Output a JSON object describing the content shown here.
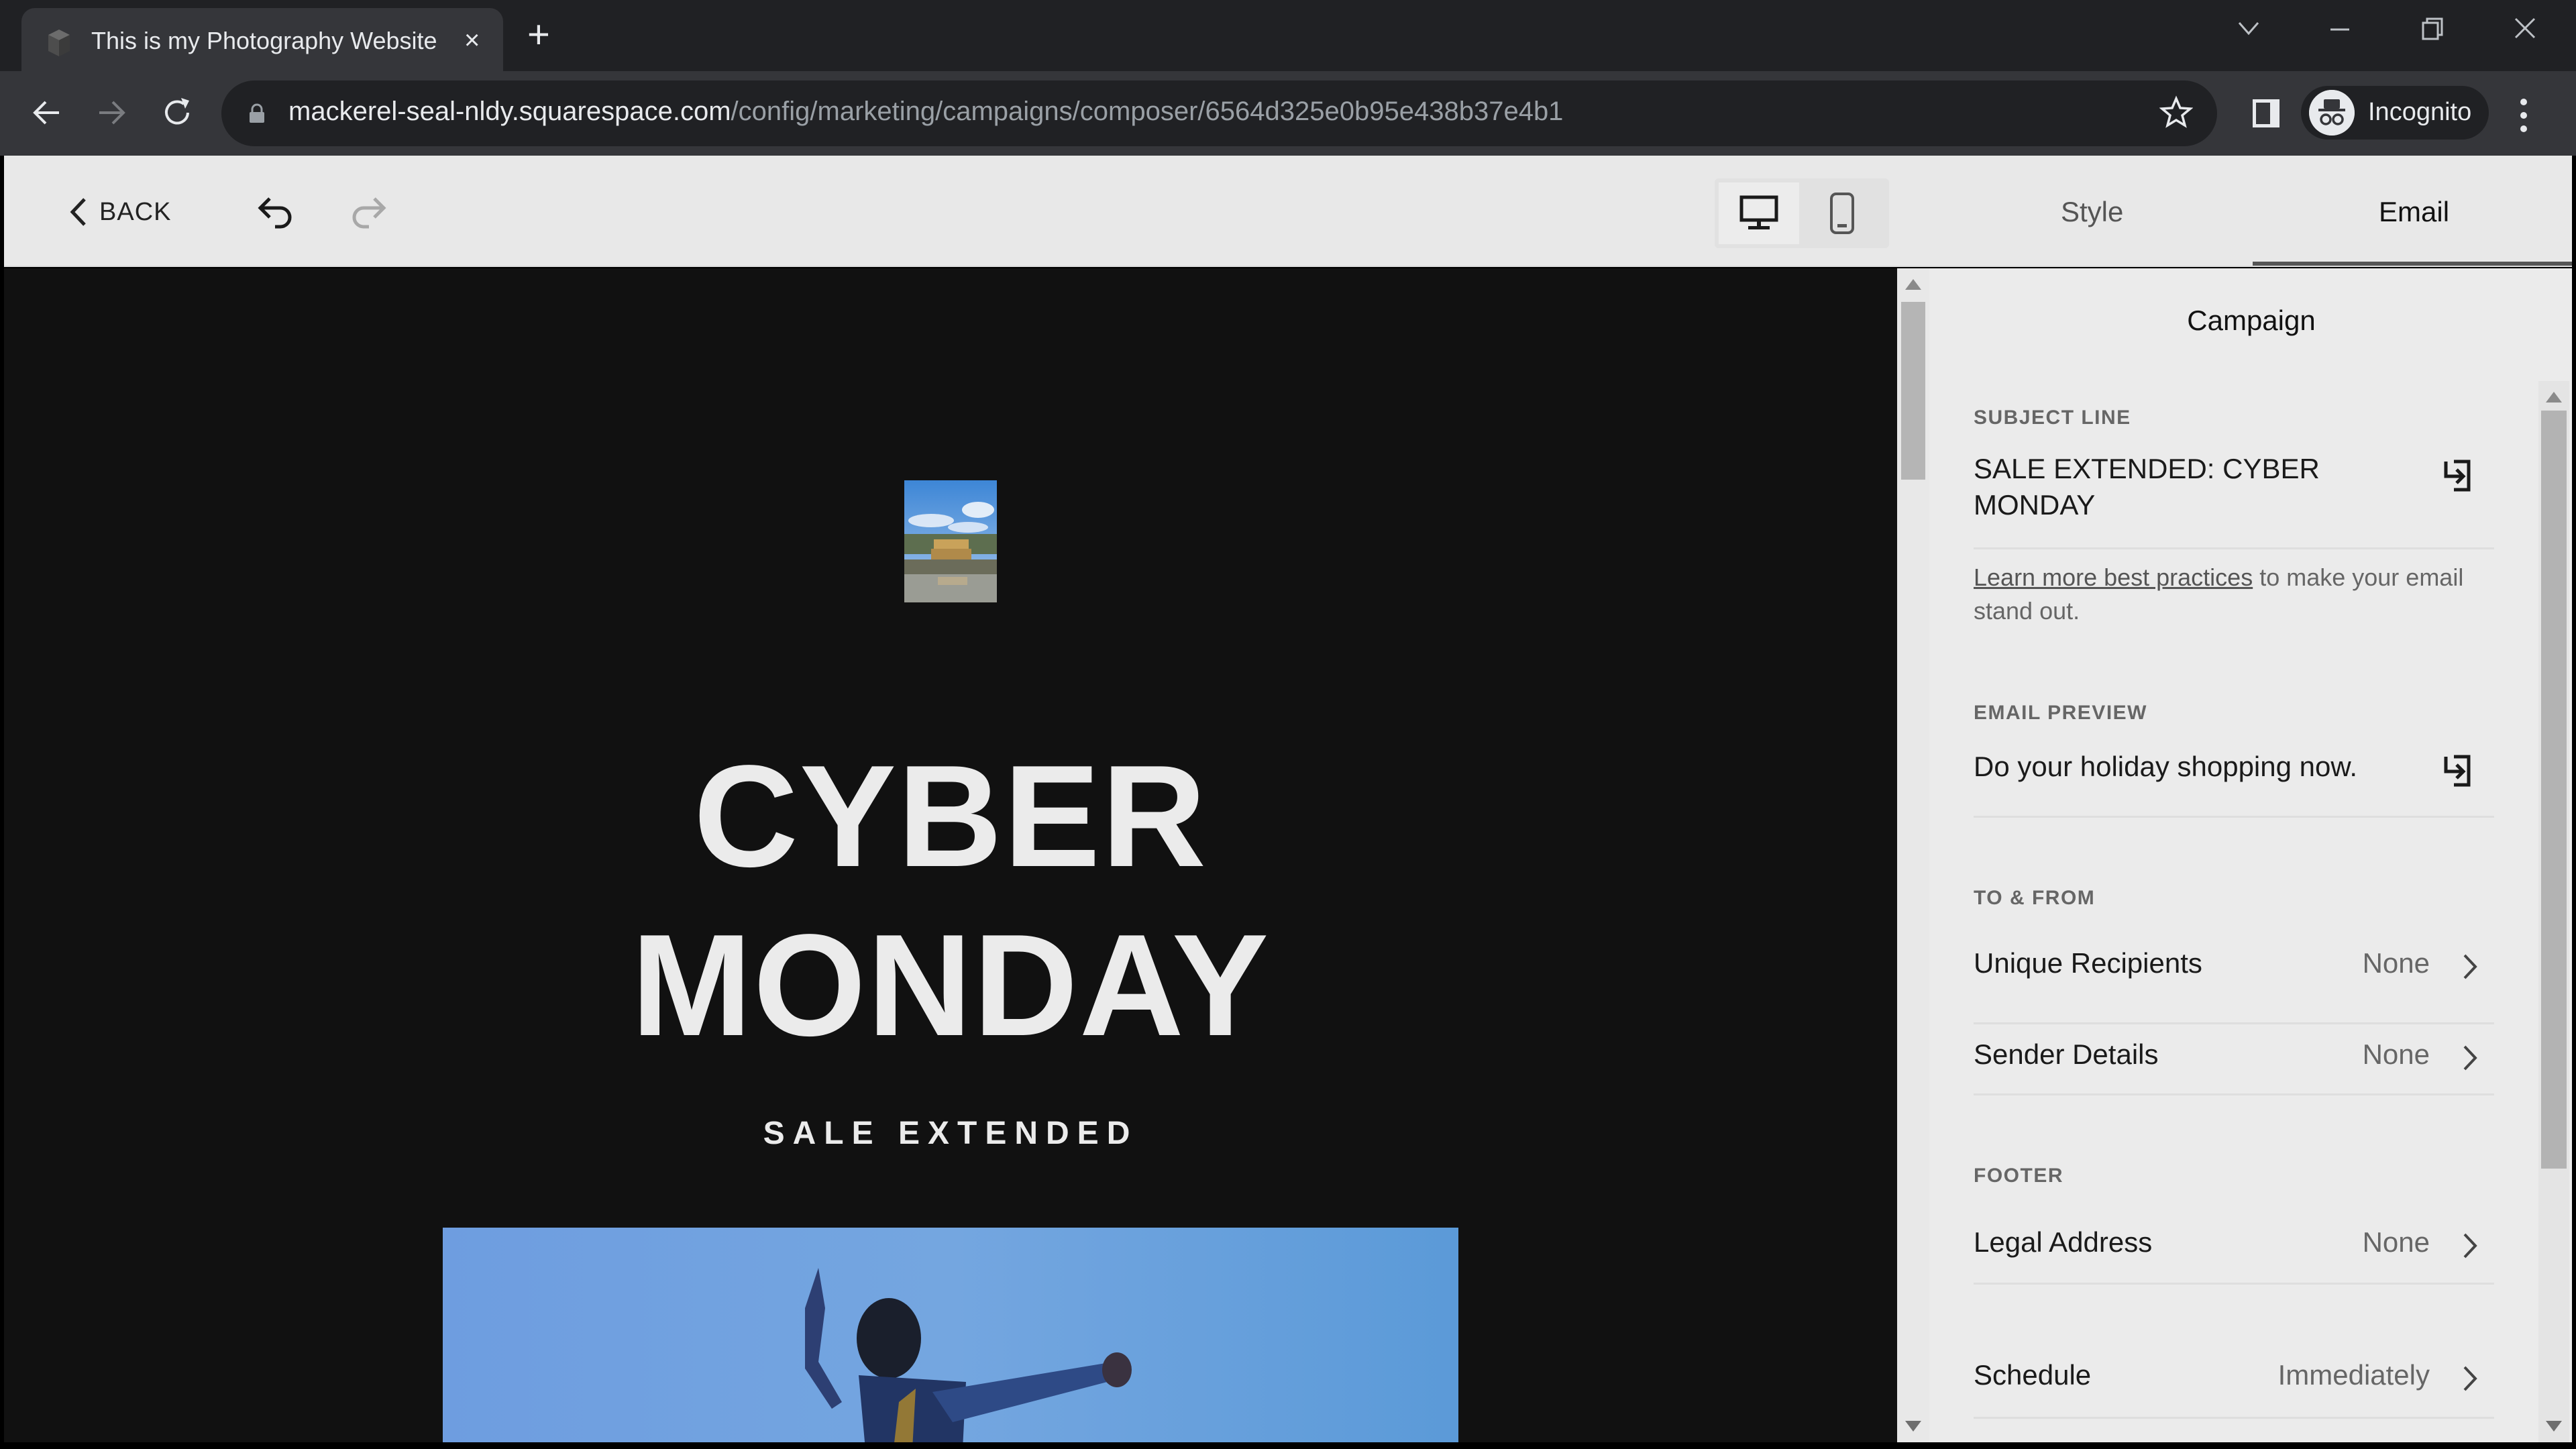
{
  "browser": {
    "tab_title": "This is my Photography Website",
    "tab_close": "×",
    "new_tab": "+",
    "url_host": "mackerel-seal-nldy.squarespace.com",
    "url_path": "/config/marketing/campaigns/composer/6564d325e0b95e438b37e4b1",
    "profile_label": "Incognito",
    "window_controls": {
      "tab_search": "⌄",
      "minimize": "—",
      "restore": "❐",
      "close": "✕"
    }
  },
  "header": {
    "back_label": "BACK",
    "device_modes": [
      "desktop",
      "mobile"
    ],
    "active_device": "desktop",
    "tabs": [
      {
        "label": "Style",
        "active": false
      },
      {
        "label": "Email",
        "active": true
      }
    ]
  },
  "preview": {
    "headline_line1": "CYBER",
    "headline_line2": "MONDAY",
    "subhead": "SALE EXTENDED",
    "logo_image": "temple-photo",
    "hero_image": "dancer-blue-sky-photo"
  },
  "panel": {
    "title": "Campaign",
    "subject_line": {
      "label": "SUBJECT LINE",
      "value": "SALE EXTENDED: CYBER MONDAY"
    },
    "help": {
      "link_text": "Learn more best practices",
      "rest_text": " to make your email stand out."
    },
    "email_preview": {
      "label": "EMAIL PREVIEW",
      "value": "Do your holiday shopping now."
    },
    "to_from": {
      "label": "TO & FROM",
      "rows": [
        {
          "label": "Unique Recipients",
          "value": "None"
        },
        {
          "label": "Sender Details",
          "value": "None"
        }
      ]
    },
    "footer": {
      "label": "FOOTER",
      "rows": [
        {
          "label": "Legal Address",
          "value": "None"
        }
      ]
    },
    "schedule": {
      "label": "Schedule",
      "value": "Immediately"
    }
  },
  "colors": {
    "chrome_dark": "#202124",
    "chrome_tab": "#35363a",
    "header_bg": "#e8e8e8",
    "preview_bg": "#111111",
    "panel_bg": "#ebebeb",
    "hero_sky": "#6a9fdc"
  }
}
